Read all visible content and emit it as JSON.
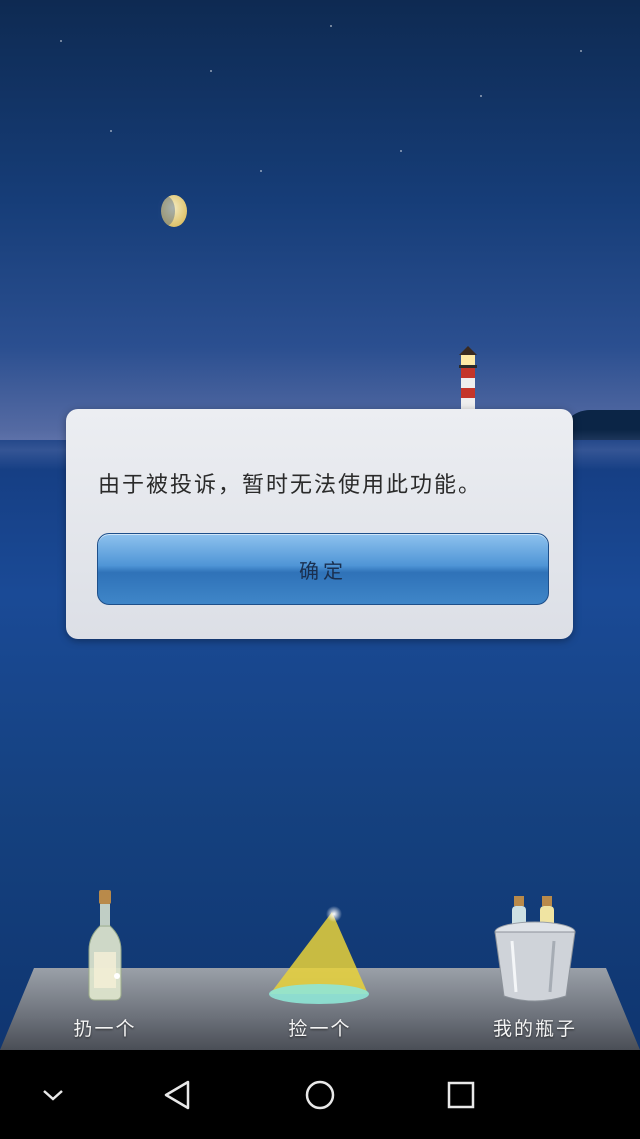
{
  "dialog": {
    "message": "由于被投诉，暂时无法使用此功能。",
    "confirm_label": "确定"
  },
  "toolbar": {
    "items": [
      {
        "label": "扔一个",
        "icon": "bottle-icon"
      },
      {
        "label": "捡一个",
        "icon": "spotlight-icon"
      },
      {
        "label": "我的瓶子",
        "icon": "bottle-bucket-icon"
      }
    ]
  },
  "navbar": {
    "items": [
      {
        "icon": "chevron-down-icon"
      },
      {
        "icon": "back-triangle-icon"
      },
      {
        "icon": "home-circle-icon"
      },
      {
        "icon": "recents-square-icon"
      }
    ]
  },
  "colors": {
    "sky_top": "#0e2a52",
    "sea": "#1a4a96",
    "dialog_bg": "#e6e8ee",
    "button_blue": "#3f86c8",
    "navbar_bg": "#000000"
  }
}
